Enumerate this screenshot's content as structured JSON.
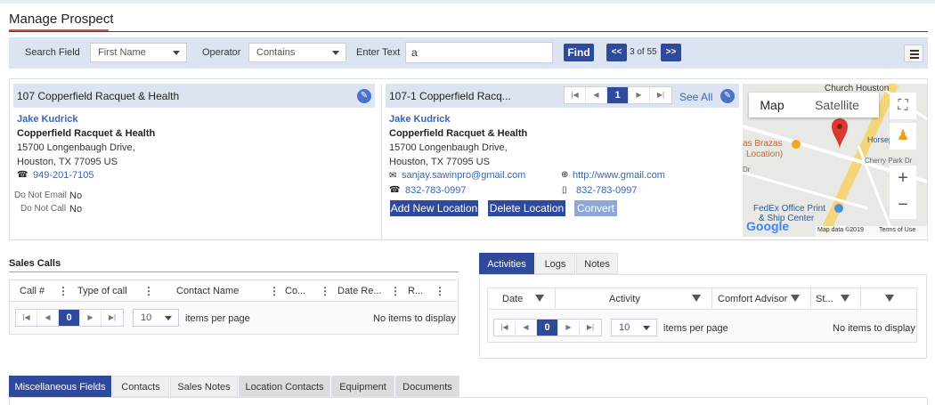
{
  "page_title": "Manage Prospect",
  "search": {
    "field_label": "Search Field",
    "field_value": "First Name",
    "operator_label": "Operator",
    "operator_value": "Contains",
    "text_label": "Enter Text",
    "text_value": "a",
    "find_label": "Find",
    "prev_label": "<<",
    "next_label": ">>",
    "record_pos": "3 of 55"
  },
  "card_left": {
    "title": "107 Copperfield Racquet & Health",
    "contact_name": "Jake Kudrick",
    "company": "Copperfield Racquet & Health",
    "address1": "15700 Longenbaugh Drive,",
    "address2": "Houston, TX 77095 US",
    "phone": "949-201-7105",
    "do_not_email_label": "Do Not Email",
    "do_not_email_value": "No",
    "do_not_call_label": "Do Not Call",
    "do_not_call_value": "No"
  },
  "card_right": {
    "title": "107-1 Copperfield Racq...",
    "page_num": "1",
    "see_all": "See All",
    "contact_name": "Jake Kudrick",
    "company": "Copperfield Racquet & Health",
    "address1": "15700 Longenbaugh Drive,",
    "address2": "Houston, TX 77095 US",
    "email": "sanjay.sawinpro@gmail.com",
    "website": "http://www.gmail.com",
    "phone": "832-783-0997",
    "mobile": "832-783-0997",
    "add_location": "Add New Location",
    "delete_location": "Delete Location",
    "convert": "Convert"
  },
  "map": {
    "tab_map": "Map",
    "tab_satellite": "Satellite",
    "label_church": "Church Houston",
    "label_brazas": "as Brazas",
    "label_location": "Location)",
    "label_fedex1": "FedEx Office Print",
    "label_fedex2": "& Ship Center",
    "label_horse": "Horsep",
    "label_cherry": "Cherry Park Dr",
    "label_dr": "Dr",
    "google": "Google",
    "map_data": "Map data ©2019",
    "terms": "Terms of Use"
  },
  "sales_calls": {
    "title": "Sales Calls",
    "columns": [
      "Call #",
      "Type of call",
      "Contact Name",
      "Co...",
      "Date Re...",
      "R..."
    ],
    "page_num": "0",
    "page_size": "10",
    "per_page_label": "items per page",
    "empty_label": "No items to display"
  },
  "activities": {
    "tabs": [
      "Activities",
      "Logs",
      "Notes"
    ],
    "columns": [
      "Date",
      "Activity",
      "Comfort Advisor",
      "St..."
    ],
    "page_num": "0",
    "page_size": "10",
    "per_page_label": "items per page",
    "empty_label": "No items to display"
  },
  "bottom_tabs": [
    "Miscellaneous Fields",
    "Contacts",
    "Sales Notes",
    "Location Contacts",
    "Equipment",
    "Documents"
  ],
  "colors": {
    "accent": "#2f4a9b",
    "header_bg": "#dce4f2",
    "link": "#3a64b8"
  }
}
